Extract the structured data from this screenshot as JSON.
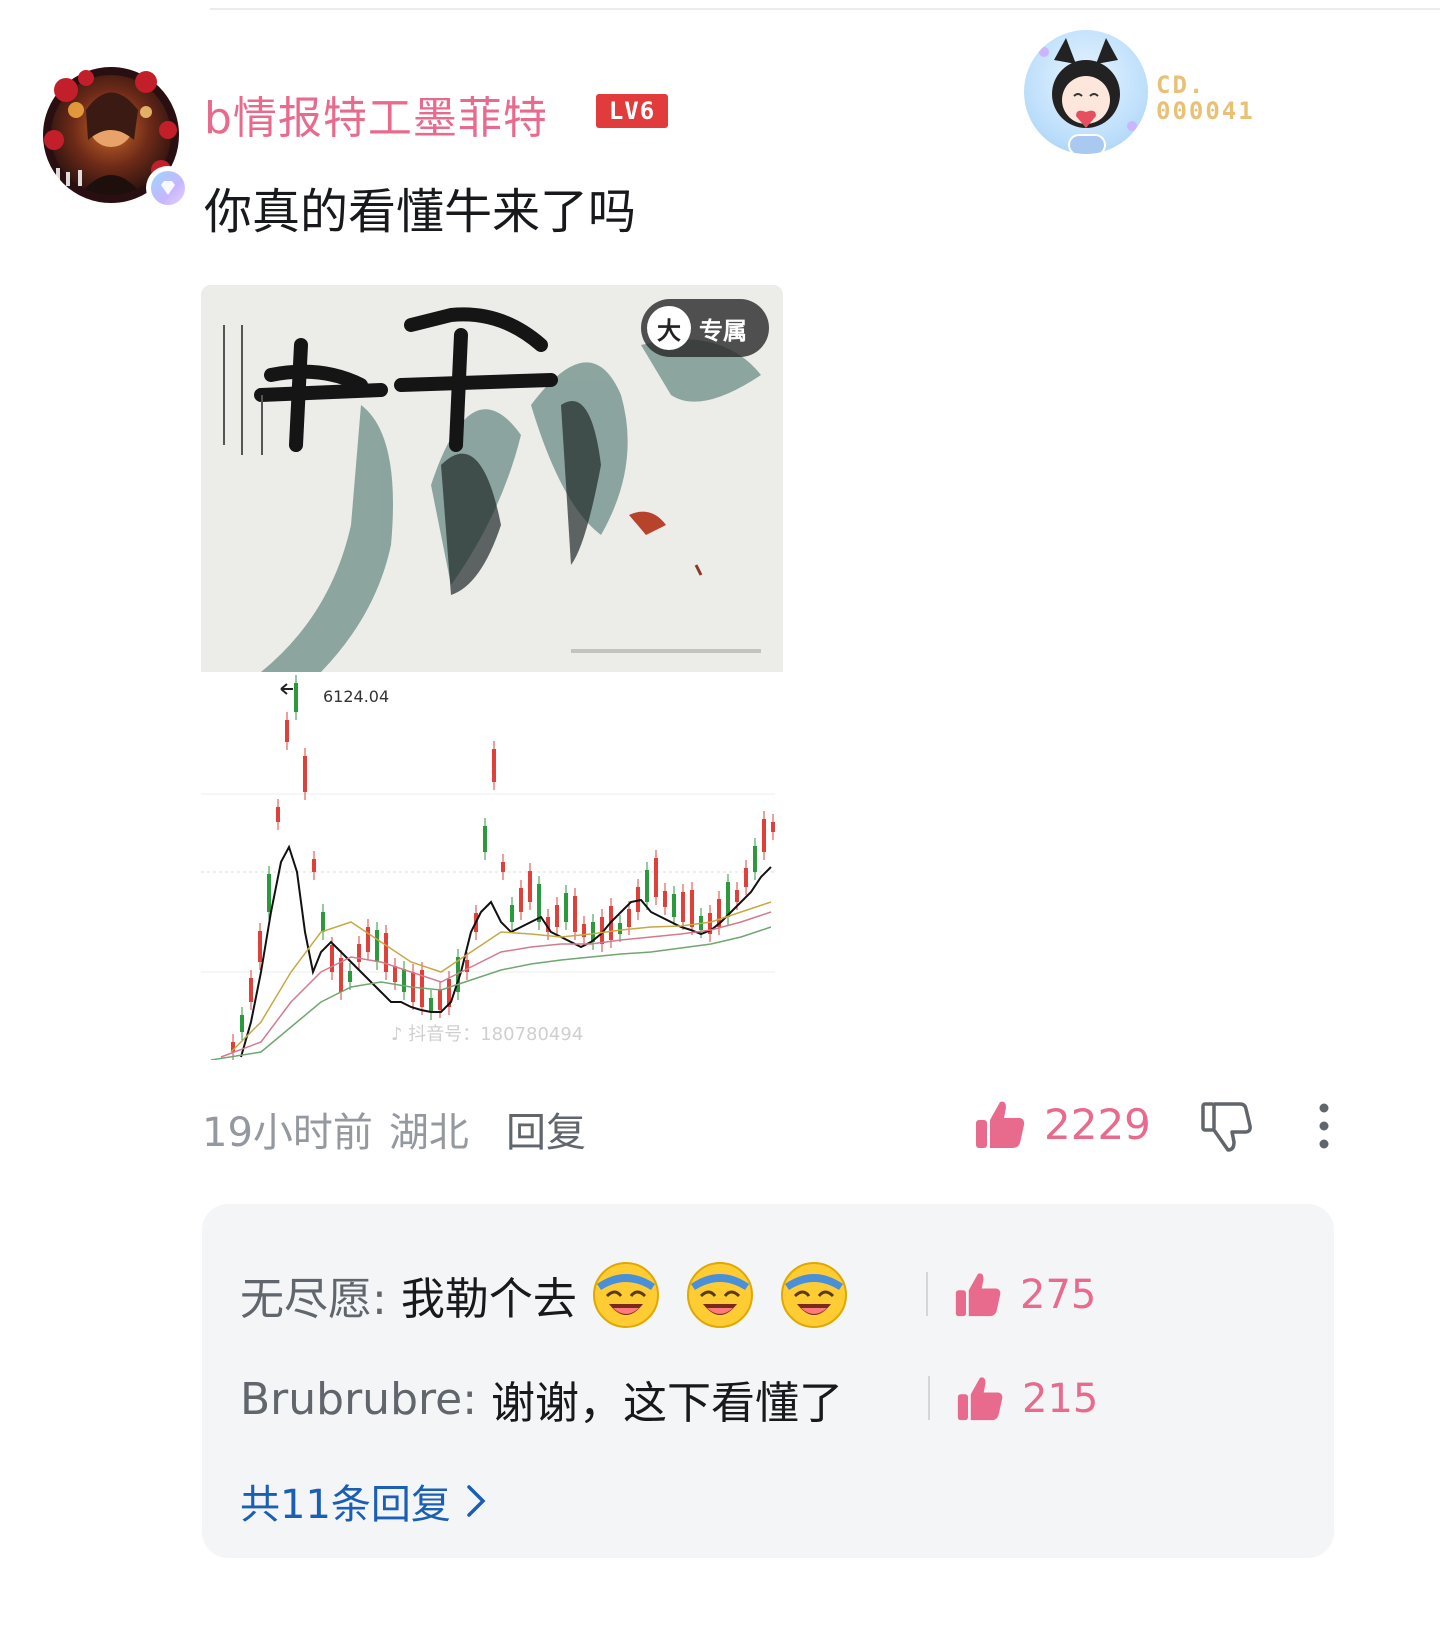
{
  "comment": {
    "username": "b情报特工墨菲特",
    "level": "LV6",
    "text": "你真的看懂牛来了吗",
    "fan_badge": {
      "line1": "CD.",
      "line2": "000041"
    },
    "image1": {
      "tag": "专属",
      "tag_icon_char": "大"
    },
    "image2": {
      "price_label": "6124.04"
    },
    "meta": {
      "time": "19小时前",
      "location": "湖北",
      "reply_label": "回复"
    },
    "likes": "2229"
  },
  "replies": {
    "items": [
      {
        "user": "无尽愿:",
        "text": "我勒个去",
        "emoji_count": 3,
        "likes": "275"
      },
      {
        "user": "Brubrubre:",
        "text": "谢谢，这下看懂了",
        "emoji_count": 0,
        "likes": "215"
      }
    ],
    "more_label": "共11条回复"
  },
  "colors": {
    "username": "#e86b8e",
    "like": "#e86b8e",
    "link": "#1a5fb4",
    "level_badge": "#e23b3b",
    "reply_box": "#f4f5f7"
  },
  "icons": [
    "verify-icon",
    "like-icon",
    "dislike-icon",
    "more-vertical-icon",
    "laughing-emoji-icon",
    "chevron-right-icon"
  ]
}
